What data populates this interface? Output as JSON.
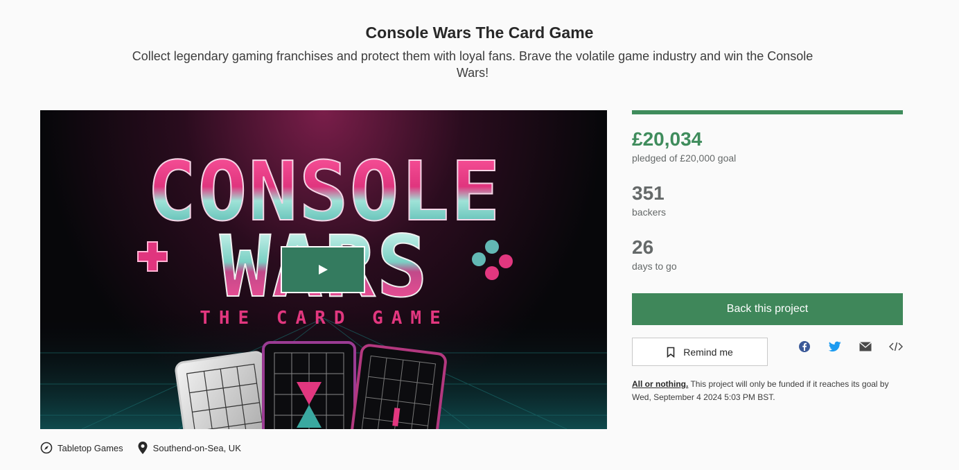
{
  "project": {
    "title": "Console Wars The Card Game",
    "blurb": "Collect legendary gaming franchises and protect them with loyal fans. Brave the volatile game industry and win the Console Wars!"
  },
  "media": {
    "art_title_line1": "CONSOLE",
    "art_title_line2": "WARS",
    "art_subtitle": "THE CARD GAME",
    "play_icon": "play-icon"
  },
  "meta": {
    "category": "Tabletop Games",
    "category_icon": "compass-icon",
    "location": "Southend-on-Sea, UK",
    "location_icon": "map-pin-icon"
  },
  "stats": {
    "pledged": "£20,034",
    "pledged_label": "pledged of £20,000 goal",
    "progress_percent": 100,
    "backers": "351",
    "backers_label": "backers",
    "days": "26",
    "days_label": "days to go"
  },
  "actions": {
    "back_label": "Back this project",
    "remind_label": "Remind me",
    "remind_icon": "bookmark-icon",
    "share_icons": [
      "facebook-icon",
      "twitter-icon",
      "email-icon",
      "embed-icon"
    ]
  },
  "fine_print": {
    "link_text": "All or nothing.",
    "text": " This project will only be funded if it reaches its goal by Wed, September 4 2024 5:03 PM BST."
  },
  "colors": {
    "accent": "#3f8c5c",
    "button": "#3f875a",
    "twitter": "#1d9bf0",
    "facebook": "#3b5998"
  }
}
